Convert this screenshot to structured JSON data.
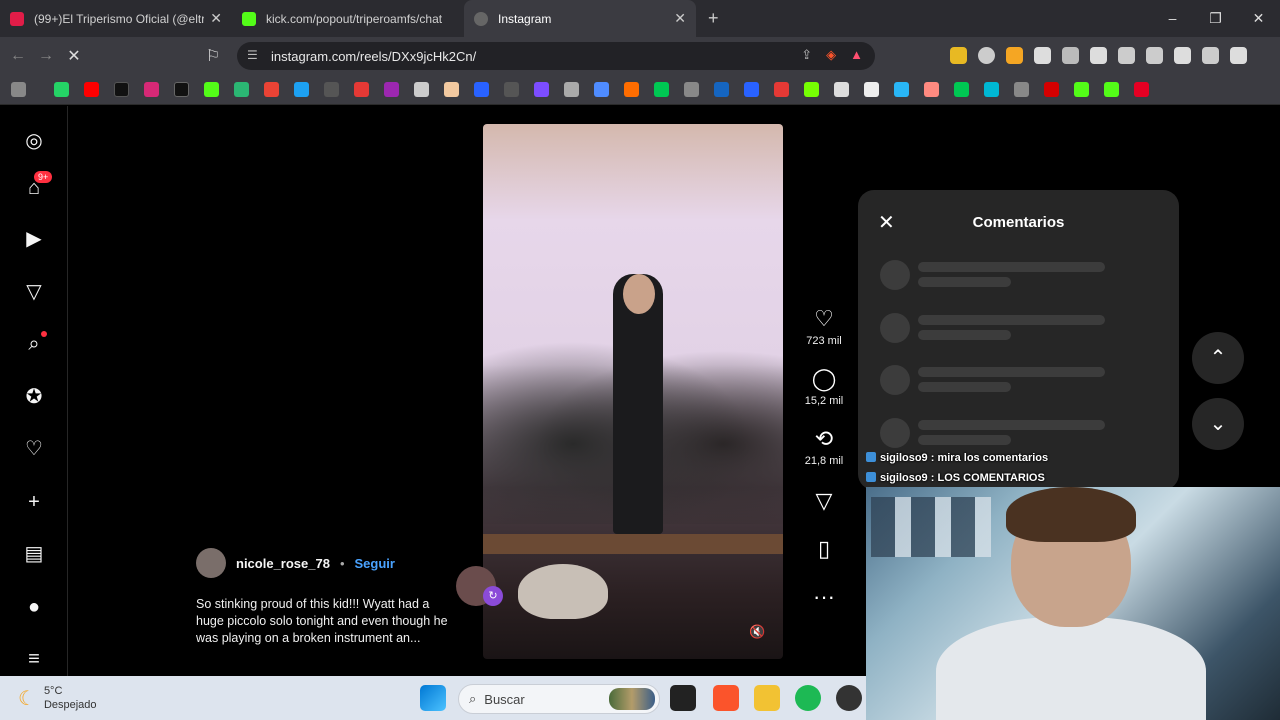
{
  "browser": {
    "tabs": [
      {
        "title": "(99+)El Triperismo Oficial (@eltriperis",
        "favicon_color": "#e11d48"
      },
      {
        "title": "kick.com/popout/triperoamfs/chat",
        "favicon_color": "#53fc18"
      },
      {
        "title": "Instagram",
        "favicon_color": "#888888"
      }
    ],
    "new_tab": "+",
    "url": "instagram.com/reels/DXx9jcHk2Cn/",
    "window_controls": {
      "minimize": "–",
      "maximize": "❐",
      "close": "✕"
    }
  },
  "instagram": {
    "nav_badge": "9+",
    "reel": {
      "likes": "723 mil",
      "comments": "15,2 mil",
      "reposts": "21,8 mil",
      "author": "nicole_rose_78",
      "separator": "•",
      "follow": "Seguir",
      "caption": "So stinking proud of this kid!!! Wyatt had a huge piccolo solo tonight and even though he was playing on a broken instrument an..."
    },
    "comments_panel": {
      "title": "Comentarios"
    }
  },
  "stream_chat": [
    {
      "user": "sigiloso9",
      "message": "mira los comentarios"
    },
    {
      "user": "sigiloso9",
      "message": "LOS COMENTARIOS"
    }
  ],
  "taskbar": {
    "temperature": "5°C",
    "condition": "Despejado",
    "search_placeholder": "Buscar"
  }
}
